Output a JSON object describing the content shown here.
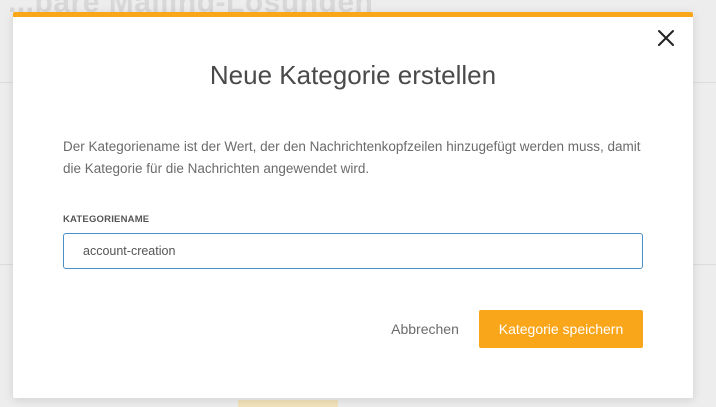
{
  "background_page": {
    "title_fragment": "...bare Mailing-Lösungen"
  },
  "modal": {
    "title": "Neue Kategorie erstellen",
    "description": "Der Kategoriename ist der Wert, der den Nachrichtenkopfzeilen hinzugefügt werden muss, damit die Kategorie für die Nachrichten angewendet wird.",
    "field": {
      "label": "KATEGORIENAME",
      "value": "account-creation"
    },
    "buttons": {
      "cancel_label": "Abbrechen",
      "save_label": "Kategorie speichern"
    }
  },
  "icons": {
    "close": "close-icon"
  },
  "colors": {
    "accent": "#f9a61a",
    "input_border_focus": "#4a90c8",
    "title_text": "#4a4a4a",
    "body_text": "#6b6b6b"
  }
}
